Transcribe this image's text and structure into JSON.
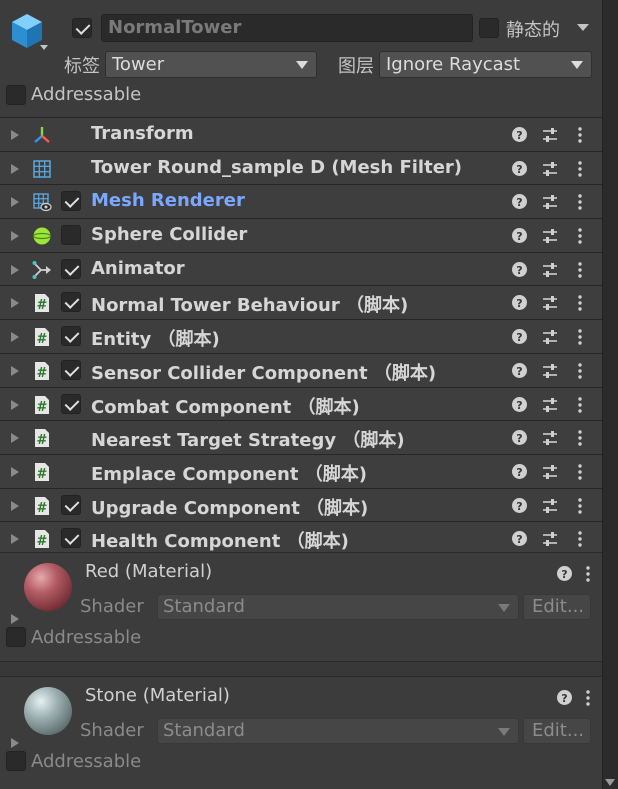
{
  "gameobject": {
    "active": true,
    "name": "NormalTower",
    "static_label": "静态的",
    "static_checked": false,
    "tag_label": "标签",
    "tag_value": "Tower",
    "layer_label": "图层",
    "layer_value": "Ignore Raycast",
    "addressable_label": "Addressable"
  },
  "components": [
    {
      "title": "Transform",
      "icon": "transform-icon",
      "has_checkbox": false,
      "checked": false
    },
    {
      "title": "Tower Round_sample D (Mesh Filter)",
      "icon": "mesh-filter-icon",
      "has_checkbox": false,
      "checked": false
    },
    {
      "title": "Mesh Renderer",
      "icon": "mesh-renderer-icon",
      "has_checkbox": true,
      "checked": true,
      "highlight": true
    },
    {
      "title": "Sphere Collider",
      "icon": "sphere-collider-icon",
      "has_checkbox": true,
      "checked": false
    },
    {
      "title": "Animator",
      "icon": "animator-icon",
      "has_checkbox": true,
      "checked": true
    },
    {
      "title": "Normal Tower Behaviour （脚本)",
      "icon": "script-icon",
      "has_checkbox": true,
      "checked": true
    },
    {
      "title": "Entity （脚本)",
      "icon": "script-icon",
      "has_checkbox": true,
      "checked": true
    },
    {
      "title": "Sensor Collider Component （脚本)",
      "icon": "script-icon",
      "has_checkbox": true,
      "checked": true
    },
    {
      "title": "Combat Component （脚本)",
      "icon": "script-icon",
      "has_checkbox": true,
      "checked": true
    },
    {
      "title": "Nearest Target Strategy （脚本)",
      "icon": "script-icon",
      "has_checkbox": false,
      "checked": false
    },
    {
      "title": "Emplace Component （脚本)",
      "icon": "script-icon",
      "has_checkbox": false,
      "checked": false
    },
    {
      "title": "Upgrade Component （脚本)",
      "icon": "script-icon",
      "has_checkbox": true,
      "checked": true
    },
    {
      "title": "Health Component （脚本)",
      "icon": "script-icon",
      "has_checkbox": true,
      "checked": true
    }
  ],
  "materials": [
    {
      "name": "Red (Material)",
      "shader_label": "Shader",
      "shader_value": "Standard",
      "edit_label": "Edit...",
      "addressable_label": "Addressable",
      "color": "#a8505a"
    },
    {
      "name": "Stone (Material)",
      "shader_label": "Shader",
      "shader_value": "Standard",
      "edit_label": "Edit...",
      "addressable_label": "Addressable",
      "color": "#8ea0a2"
    }
  ],
  "colors": {
    "background": "#383838",
    "highlight_text": "#7aa8ff",
    "cube_icon": "#3aa6e6"
  }
}
